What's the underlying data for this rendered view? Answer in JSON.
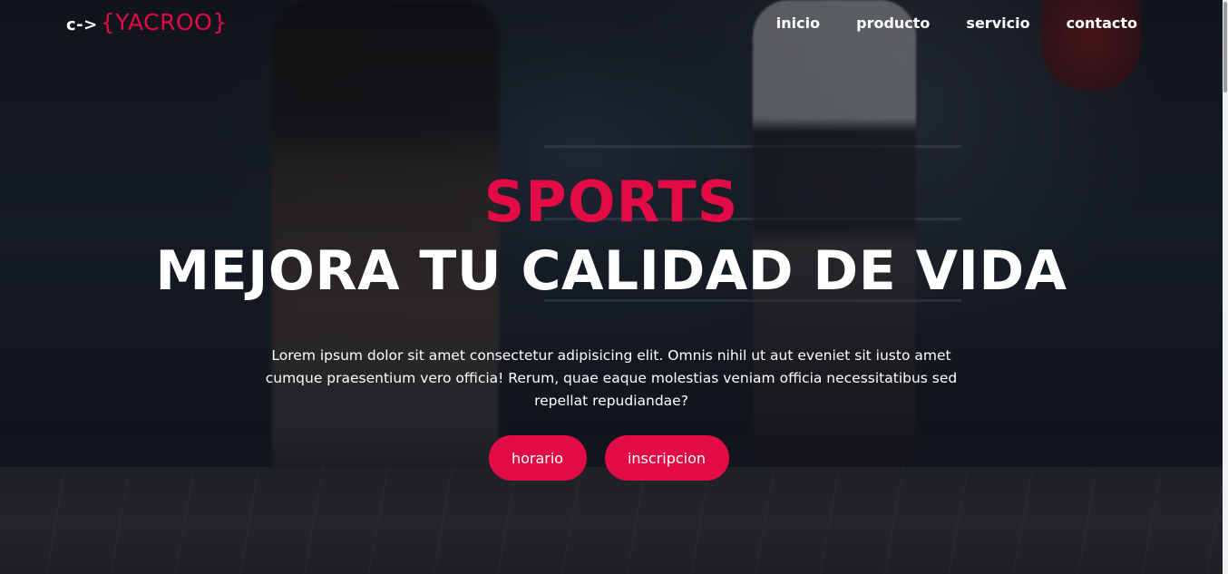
{
  "header": {
    "logo_prefix": "c->",
    "logo_name": "{YACROO}",
    "nav": [
      {
        "label": "inicio"
      },
      {
        "label": "producto"
      },
      {
        "label": "servicio"
      },
      {
        "label": "contacto"
      }
    ]
  },
  "hero": {
    "title": "SPORTS",
    "subtitle": "MEJORA TU CALIDAD DE VIDA",
    "text": "Lorem ipsum dolor sit amet consectetur adipisicing elit. Omnis nihil ut aut eveniet sit iusto amet cumque praesentium vero officia! Rerum, quae eaque molestias veniam officia necessitatibus sed repellat repudiandae?",
    "buttons": [
      {
        "label": "horario"
      },
      {
        "label": "inscripcion"
      }
    ]
  },
  "colors": {
    "accent": "#e30b45",
    "text": "#ffffff"
  }
}
